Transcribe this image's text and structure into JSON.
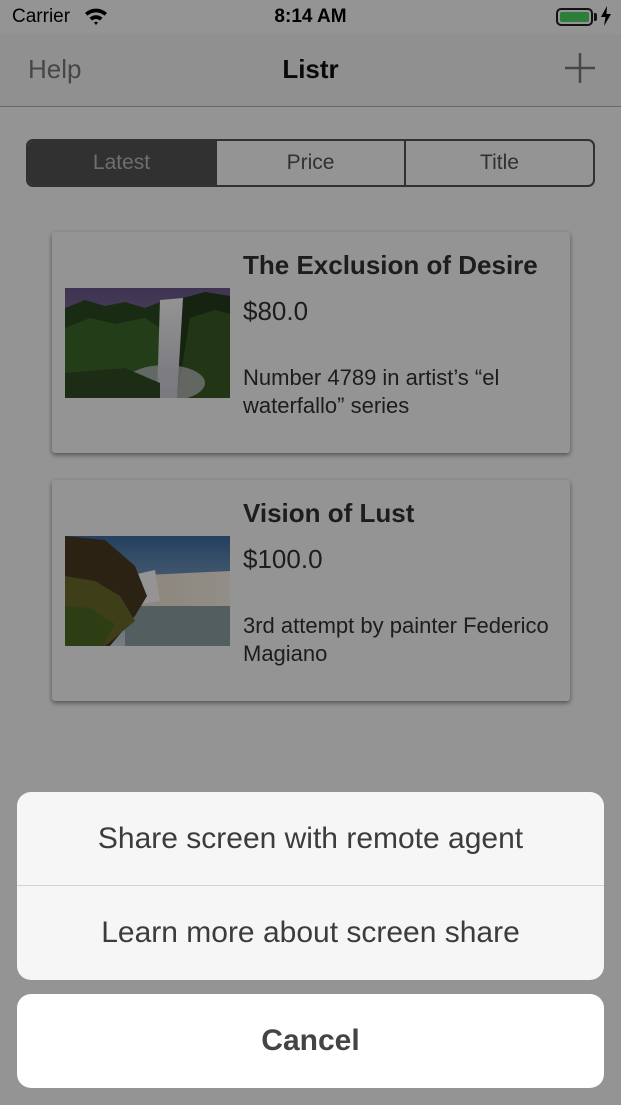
{
  "status_bar": {
    "carrier": "Carrier",
    "time": "8:14 AM",
    "battery_color": "#4cd964",
    "icons": [
      "wifi-icon",
      "battery-icon",
      "charging-bolt-icon"
    ]
  },
  "nav_bar": {
    "left_label": "Help",
    "title": "Listr",
    "right_icon": "plus-icon"
  },
  "segmented_control": {
    "segments": [
      {
        "label": "Latest",
        "selected": true
      },
      {
        "label": "Price",
        "selected": false
      },
      {
        "label": "Title",
        "selected": false
      }
    ]
  },
  "listings": [
    {
      "title": "The Exclusion of Desire",
      "price": "$80.0",
      "description": "Number 4789 in artist’s “el waterfallo” series"
    },
    {
      "title": "Vision of Lust",
      "price": "$100.0",
      "description": "3rd attempt by painter Federico Magiano"
    }
  ],
  "action_sheet": {
    "options": [
      "Share screen with remote agent",
      "Learn more about screen share"
    ],
    "cancel_label": "Cancel"
  }
}
